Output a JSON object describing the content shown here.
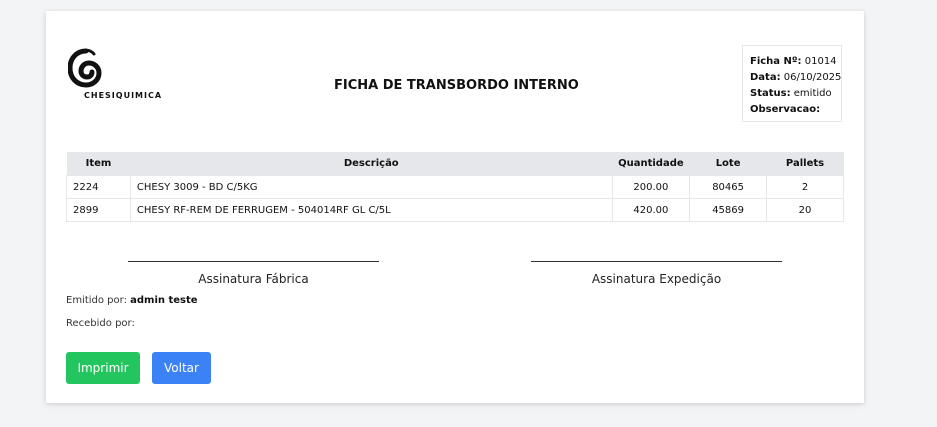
{
  "logo": {
    "text": "CHESIQUIMICA"
  },
  "document": {
    "title": "FICHA DE TRANSBORDO INTERNO"
  },
  "info": {
    "ficha_label": "Ficha Nº:",
    "ficha_value": "01014",
    "data_label": "Data:",
    "data_value": "06/10/2025",
    "status_label": "Status:",
    "status_value": "emitido",
    "obs_label": "Observacao:",
    "obs_value": ""
  },
  "table": {
    "headers": [
      "Item",
      "Descrição",
      "Quantidade",
      "Lote",
      "Pallets"
    ],
    "rows": [
      [
        "2224",
        "CHESY 3009 - BD C/5KG",
        "200.00",
        "80465",
        "2"
      ],
      [
        "2899",
        "CHESY RF-REM DE FERRUGEM - 504014RF GL C/5L",
        "420.00",
        "45869",
        "20"
      ]
    ]
  },
  "signatures": {
    "factory": "Assinatura Fábrica",
    "expedition": "Assinatura Expedição"
  },
  "issued": {
    "label": "Emitido por:",
    "value": "admin teste"
  },
  "received": {
    "label": "Recebido por:",
    "value": ""
  },
  "buttons": {
    "print": "Imprimir",
    "back": "Voltar"
  },
  "colors": {
    "print": "#22c55e",
    "back": "#3b82f6",
    "table_header": "#e5e7eb"
  }
}
